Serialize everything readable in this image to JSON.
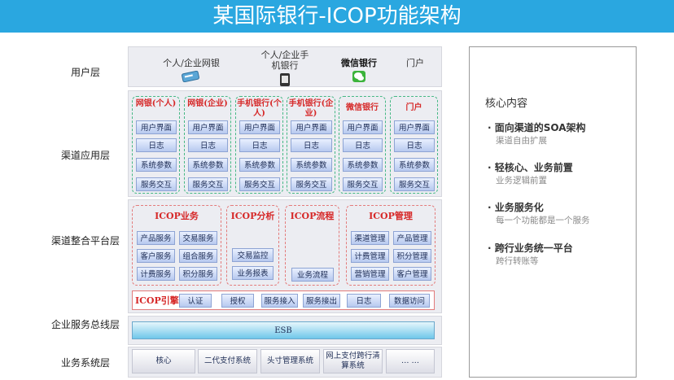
{
  "title": "某国际银行-ICOP功能架构",
  "layers": {
    "user": "用户层",
    "channel_app": "渠道应用层",
    "integration": "渠道整合平台层",
    "esb_layer": "企业服务总线层",
    "biz_sys": "业务系统层"
  },
  "user_channels": [
    {
      "label": "个人/企业网银",
      "icon": "card-icon"
    },
    {
      "label": "个人/企业手机银行",
      "icon": "phone-icon"
    },
    {
      "label": "微信银行",
      "icon": "wechat-icon"
    },
    {
      "label": "门户",
      "icon": ""
    }
  ],
  "channel_groups": [
    {
      "title": "网银(个人)",
      "items": [
        "用户界面",
        "日志",
        "系统参数",
        "服务交互"
      ]
    },
    {
      "title": "网银(企业)",
      "items": [
        "用户界面",
        "日志",
        "系统参数",
        "服务交互"
      ]
    },
    {
      "title": "手机银行(个人)",
      "items": [
        "用户界面",
        "日志",
        "系统参数",
        "服务交互"
      ]
    },
    {
      "title": "手机银行(企业)",
      "items": [
        "用户界面",
        "日志",
        "系统参数",
        "服务交互"
      ]
    },
    {
      "title": "微信银行",
      "items": [
        "用户界面",
        "日志",
        "系统参数",
        "服务交互"
      ]
    },
    {
      "title": "门户",
      "items": [
        "用户界面",
        "日志",
        "系统参数",
        "服务交互"
      ]
    }
  ],
  "icop_business": {
    "title": "ICOP业务",
    "items": [
      "产品服务",
      "交易服务",
      "客户服务",
      "组合服务",
      "计费服务",
      "积分服务"
    ]
  },
  "icop_analysis": {
    "title": "ICOP分析",
    "items": [
      "交易监控",
      "业务报表"
    ]
  },
  "icop_flow": {
    "title": "ICOP流程",
    "items": [
      "业务流程"
    ]
  },
  "icop_manage": {
    "title": "ICOP管理",
    "items": [
      "渠道管理",
      "产品管理",
      "计费管理",
      "积分管理",
      "营销管理",
      "客户管理"
    ]
  },
  "engine": {
    "title": "ICOP引擎",
    "items": [
      "认证",
      "授权",
      "服务接入",
      "服务接出",
      "日志",
      "数据访问"
    ]
  },
  "esb": "ESB",
  "systems": [
    "核心",
    "二代支付系统",
    "头寸管理系统",
    "网上支付跨行清算系统",
    "… …"
  ],
  "side": {
    "heading": "核心内容",
    "points": [
      {
        "title": "面向渠道的SOA架构",
        "sub": "渠道自由扩展"
      },
      {
        "title": "轻核心、业务前置",
        "sub": "业务逻辑前置"
      },
      {
        "title": "业务服务化",
        "sub": "每一个功能都是一个服务"
      },
      {
        "title": "跨行业务统一平台",
        "sub": "跨行转账等"
      }
    ]
  }
}
